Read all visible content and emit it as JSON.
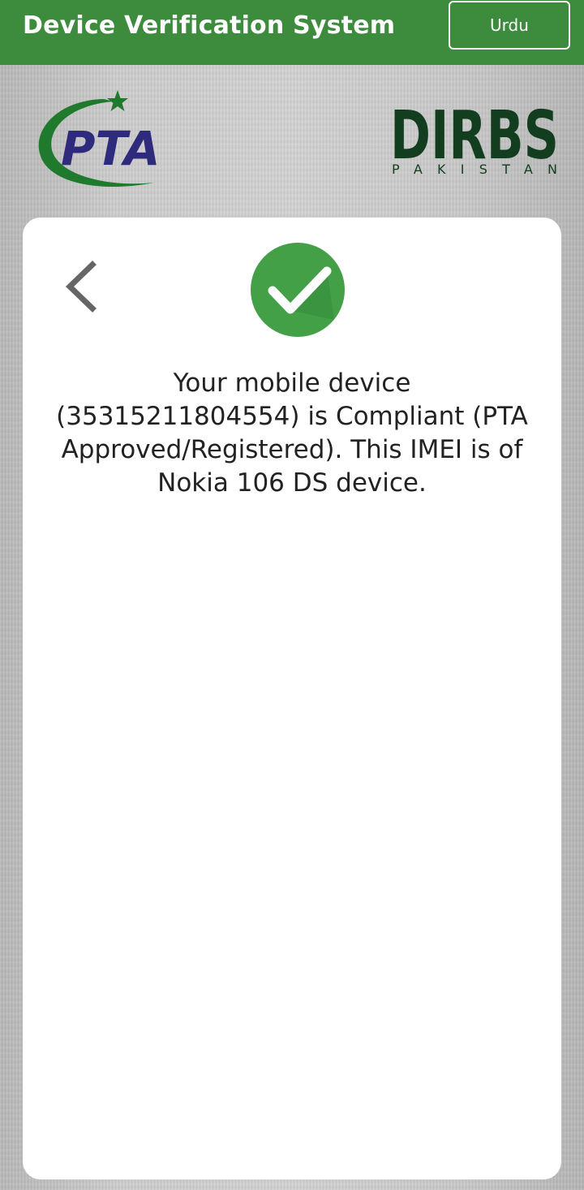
{
  "header": {
    "title": "Device Verification System",
    "language_button": "Urdu",
    "background_color": "#3d8b3d"
  },
  "logos": {
    "pta": {
      "text": "PTA",
      "icon": "pta-logo-icon",
      "text_color": "#2e2a7c",
      "swoosh_color": "#1f7a2e"
    },
    "dirbs": {
      "text": "DIRBS",
      "subtext": "PAKISTAN",
      "icon": "dirbs-logo-icon",
      "color": "#133d1f"
    }
  },
  "card": {
    "back_icon": "chevron-left-icon",
    "status_icon": "check-circle-icon",
    "status_color": "#43a047",
    "message": "Your mobile device (35315211804554) is Compliant (PTA Approved/Registered). This IMEI is of Nokia 106 DS device."
  }
}
